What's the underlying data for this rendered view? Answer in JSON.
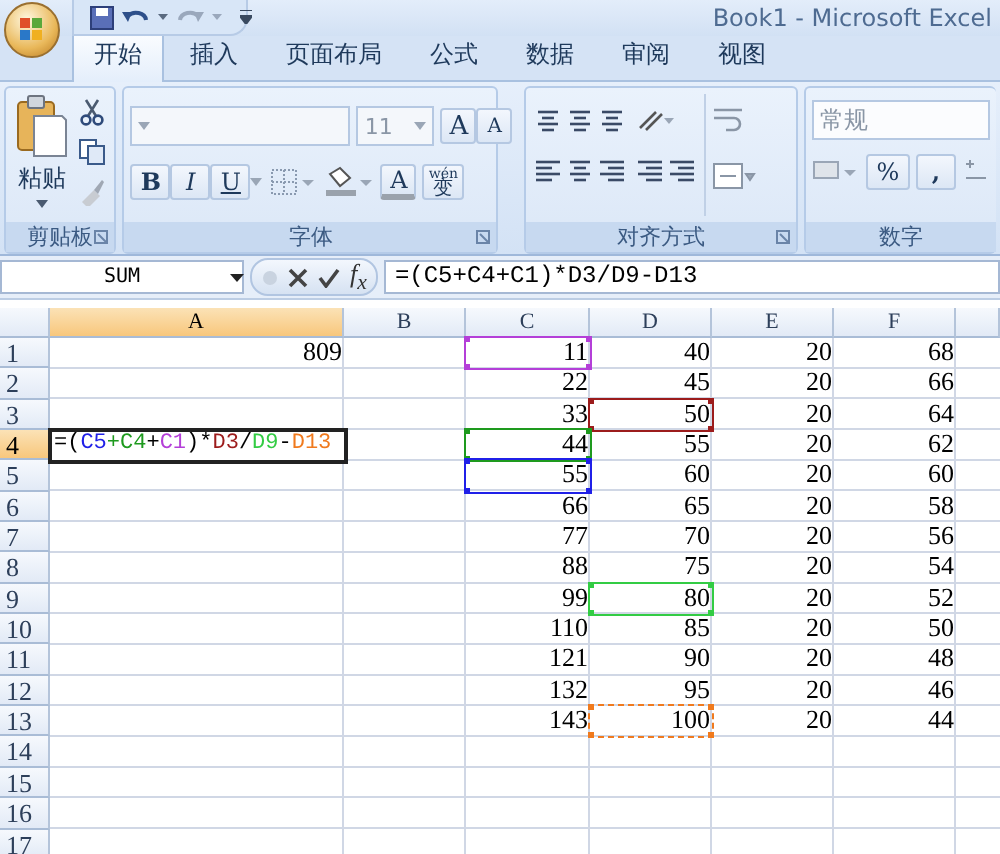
{
  "title_bar": {
    "title": "Book1 - Microsoft Excel"
  },
  "tabs": [
    {
      "label": "开始",
      "selected": true
    },
    {
      "label": "插入",
      "selected": false
    },
    {
      "label": "页面布局",
      "selected": false
    },
    {
      "label": "公式",
      "selected": false
    },
    {
      "label": "数据",
      "selected": false
    },
    {
      "label": "审阅",
      "selected": false
    },
    {
      "label": "视图",
      "selected": false
    }
  ],
  "ribbon": {
    "groups": [
      {
        "kind": "clipboard",
        "label": "剪贴板",
        "paste_label": "粘贴"
      },
      {
        "kind": "font",
        "label": "字体",
        "font_size": "11",
        "grow_label": "A",
        "shrink_label": "A",
        "bold_label": "B",
        "italic_label": "I",
        "underline_label": "U",
        "color_label": "A",
        "phonetic_label": "变",
        "phonetic_hint": "wén"
      },
      {
        "kind": "alignment",
        "label": "对齐方式"
      },
      {
        "kind": "number",
        "label": "数字",
        "format": "常规",
        "percent_label": "%",
        "comma_label": ","
      }
    ]
  },
  "formula_bar": {
    "name_box": "SUM",
    "function_label": "f$_{x}$",
    "formula": "=(C5+C4+C1)*D3/D9-D13"
  },
  "sheet": {
    "columns": [
      {
        "label": "A",
        "selected": true
      },
      {
        "label": "B",
        "selected": false
      },
      {
        "label": "C",
        "selected": false
      },
      {
        "label": "D",
        "selected": false
      },
      {
        "label": "E",
        "selected": false
      },
      {
        "label": "F",
        "selected": false
      }
    ],
    "rows": [
      {
        "label": "1",
        "selected": false,
        "cells": [
          {
            "kind": "plain",
            "value": "809"
          },
          null,
          {
            "kind": "reference",
            "value": "11",
            "color": "#b43fd8"
          },
          {
            "kind": "plain",
            "value": "40"
          },
          {
            "kind": "plain",
            "value": "20"
          },
          {
            "kind": "plain",
            "value": "68"
          }
        ]
      },
      {
        "label": "2",
        "selected": false,
        "cells": [
          null,
          null,
          {
            "kind": "plain",
            "value": "22"
          },
          {
            "kind": "plain",
            "value": "45"
          },
          {
            "kind": "plain",
            "value": "20"
          },
          {
            "kind": "plain",
            "value": "66"
          }
        ]
      },
      {
        "label": "3",
        "selected": false,
        "cells": [
          null,
          null,
          {
            "kind": "plain",
            "value": "33"
          },
          {
            "kind": "reference",
            "value": "50",
            "color": "#9c1c1c"
          },
          {
            "kind": "plain",
            "value": "20"
          },
          {
            "kind": "plain",
            "value": "64"
          }
        ]
      },
      {
        "label": "4",
        "selected": true,
        "cells": [
          {
            "kind": "editing",
            "parts": [
              {
                "text": "=(",
                "color": "#000000"
              },
              {
                "text": "C5",
                "color": "#2020e8"
              },
              {
                "text": "+",
                "color": "#1e9a1e"
              },
              {
                "text": "C4",
                "color": "#1e9a1e"
              },
              {
                "text": "+",
                "color": "#000000"
              },
              {
                "text": "C1",
                "color": "#b43fd8"
              },
              {
                "text": ")*",
                "color": "#000000"
              },
              {
                "text": "D3",
                "color": "#9c1c1c"
              },
              {
                "text": "/",
                "color": "#000000"
              },
              {
                "text": "D9",
                "color": "#33cc44"
              },
              {
                "text": "-",
                "color": "#000000"
              },
              {
                "text": "D13",
                "color": "#f07a1e"
              }
            ]
          },
          null,
          {
            "kind": "reference",
            "value": "44",
            "color": "#1e9a1e"
          },
          {
            "kind": "plain",
            "value": "55"
          },
          {
            "kind": "plain",
            "value": "20"
          },
          {
            "kind": "plain",
            "value": "62"
          }
        ]
      },
      {
        "label": "5",
        "selected": false,
        "cells": [
          null,
          null,
          {
            "kind": "reference",
            "value": "55",
            "color": "#2020e8"
          },
          {
            "kind": "plain",
            "value": "60"
          },
          {
            "kind": "plain",
            "value": "20"
          },
          {
            "kind": "plain",
            "value": "60"
          }
        ]
      },
      {
        "label": "6",
        "selected": false,
        "cells": [
          null,
          null,
          {
            "kind": "plain",
            "value": "66"
          },
          {
            "kind": "plain",
            "value": "65"
          },
          {
            "kind": "plain",
            "value": "20"
          },
          {
            "kind": "plain",
            "value": "58"
          }
        ]
      },
      {
        "label": "7",
        "selected": false,
        "cells": [
          null,
          null,
          {
            "kind": "plain",
            "value": "77"
          },
          {
            "kind": "plain",
            "value": "70"
          },
          {
            "kind": "plain",
            "value": "20"
          },
          {
            "kind": "plain",
            "value": "56"
          }
        ]
      },
      {
        "label": "8",
        "selected": false,
        "cells": [
          null,
          null,
          {
            "kind": "plain",
            "value": "88"
          },
          {
            "kind": "plain",
            "value": "75"
          },
          {
            "kind": "plain",
            "value": "20"
          },
          {
            "kind": "plain",
            "value": "54"
          }
        ]
      },
      {
        "label": "9",
        "selected": false,
        "cells": [
          null,
          null,
          {
            "kind": "plain",
            "value": "99"
          },
          {
            "kind": "reference",
            "value": "80",
            "color": "#33cc44"
          },
          {
            "kind": "plain",
            "value": "20"
          },
          {
            "kind": "plain",
            "value": "52"
          }
        ]
      },
      {
        "label": "10",
        "selected": false,
        "cells": [
          null,
          null,
          {
            "kind": "plain",
            "value": "110"
          },
          {
            "kind": "plain",
            "value": "85"
          },
          {
            "kind": "plain",
            "value": "20"
          },
          {
            "kind": "plain",
            "value": "50"
          }
        ]
      },
      {
        "label": "11",
        "selected": false,
        "cells": [
          null,
          null,
          {
            "kind": "plain",
            "value": "121"
          },
          {
            "kind": "plain",
            "value": "90"
          },
          {
            "kind": "plain",
            "value": "20"
          },
          {
            "kind": "plain",
            "value": "48"
          }
        ]
      },
      {
        "label": "12",
        "selected": false,
        "cells": [
          null,
          null,
          {
            "kind": "plain",
            "value": "132"
          },
          {
            "kind": "plain",
            "value": "95"
          },
          {
            "kind": "plain",
            "value": "20"
          },
          {
            "kind": "plain",
            "value": "46"
          }
        ]
      },
      {
        "label": "13",
        "selected": false,
        "cells": [
          null,
          null,
          {
            "kind": "plain",
            "value": "143"
          },
          {
            "kind": "marquee",
            "value": "100",
            "color": "#f07a1e"
          },
          {
            "kind": "plain",
            "value": "20"
          },
          {
            "kind": "plain",
            "value": "44"
          }
        ]
      },
      {
        "label": "14",
        "selected": false
      },
      {
        "label": "15",
        "selected": false
      },
      {
        "label": "16",
        "selected": false
      },
      {
        "label": "17",
        "selected": false
      }
    ]
  }
}
